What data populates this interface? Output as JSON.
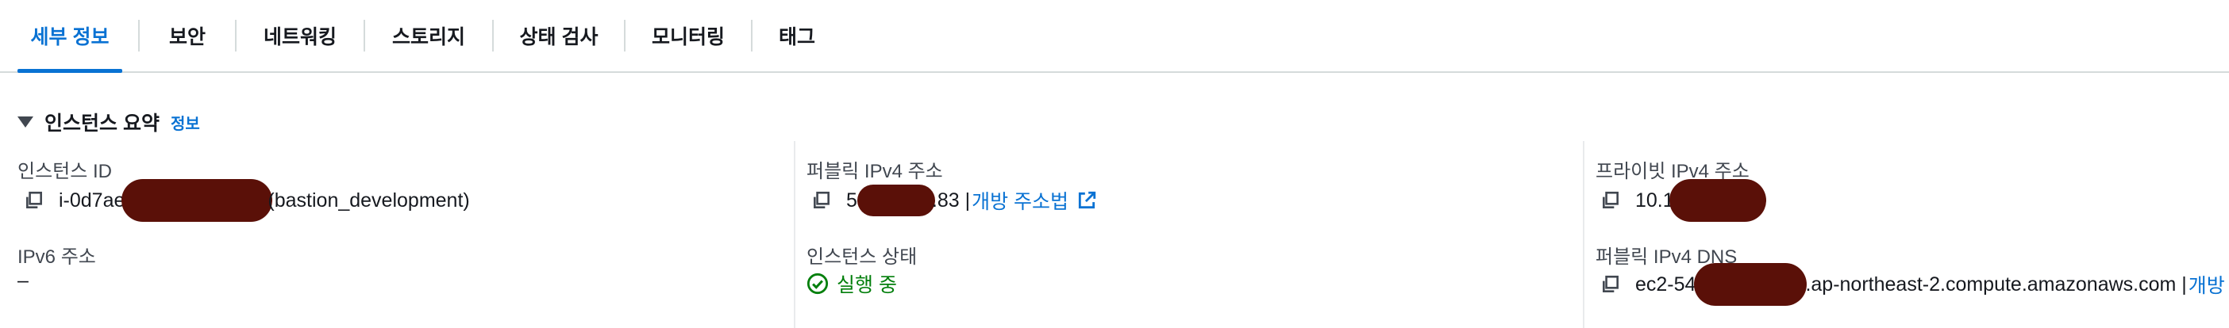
{
  "tabs": [
    {
      "label": "세부 정보",
      "active": true
    },
    {
      "label": "보안"
    },
    {
      "label": "네트워킹"
    },
    {
      "label": "스토리지"
    },
    {
      "label": "상태 검사"
    },
    {
      "label": "모니터링"
    },
    {
      "label": "태그"
    }
  ],
  "section": {
    "title": "인스턴스 요약",
    "info": "정보"
  },
  "fields": {
    "instance_id": {
      "label": "인스턴스 ID",
      "value_start": "i-0d7ae",
      "value_end": "(bastion_development)"
    },
    "ipv6": {
      "label": "IPv6 주소",
      "value": "–"
    },
    "public_ipv4": {
      "label": "퍼블릭 IPv4 주소",
      "value_start": "5",
      "value_end": ".83 |",
      "link": "개방 주소법"
    },
    "instance_state": {
      "label": "인스턴스 상태",
      "value": "실행 중"
    },
    "private_ipv4": {
      "label": "프라이빗 IPv4 주소",
      "value_start": "10.1"
    },
    "public_dns": {
      "label": "퍼블릭 IPv4 DNS",
      "value_start": "ec2-54",
      "value_end": ".ap-northeast-2.compute.amazonaws.com |",
      "link": "개방"
    }
  },
  "colors": {
    "accent": "#0972d3",
    "success": "#037f0c",
    "redaction": "#5a1008"
  },
  "icons": [
    "copy-icon",
    "external-link-icon",
    "check-circle-icon",
    "caret-down-icon"
  ]
}
